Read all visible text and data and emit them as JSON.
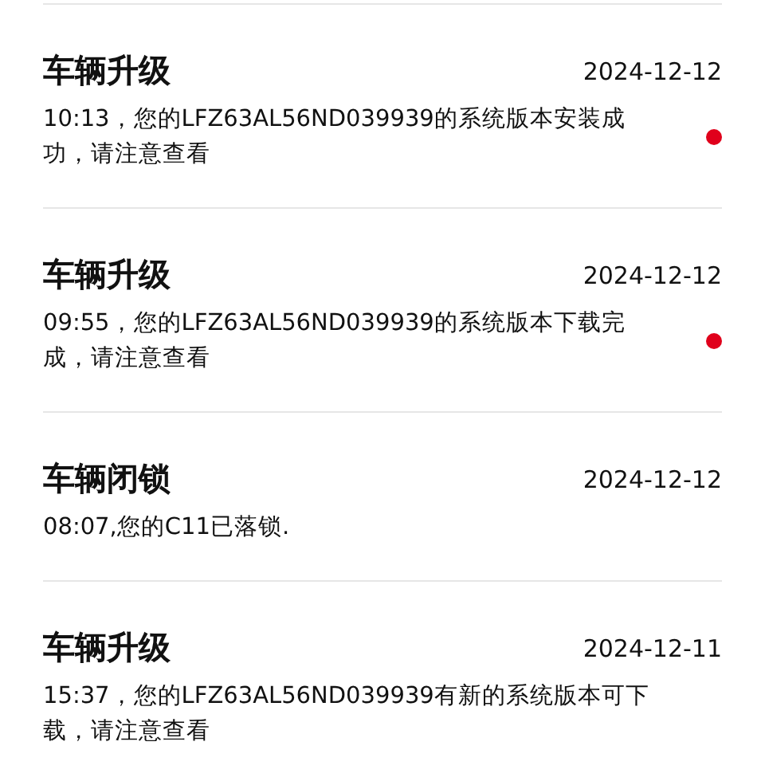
{
  "notifications": [
    {
      "title": "车辆升级",
      "date": "2024-12-12",
      "message": "10:13，您的LFZ63AL56ND039939的系统版本安装成功，请注意查看",
      "unread": true
    },
    {
      "title": "车辆升级",
      "date": "2024-12-12",
      "message": "09:55，您的LFZ63AL56ND039939的系统版本下载完成，请注意查看",
      "unread": true
    },
    {
      "title": "车辆闭锁",
      "date": "2024-12-12",
      "message": "08:07,您的C11已落锁.",
      "unread": false
    },
    {
      "title": "车辆升级",
      "date": "2024-12-11",
      "message": "15:37，您的LFZ63AL56ND039939有新的系统版本可下载，请注意查看",
      "unread": false
    }
  ]
}
